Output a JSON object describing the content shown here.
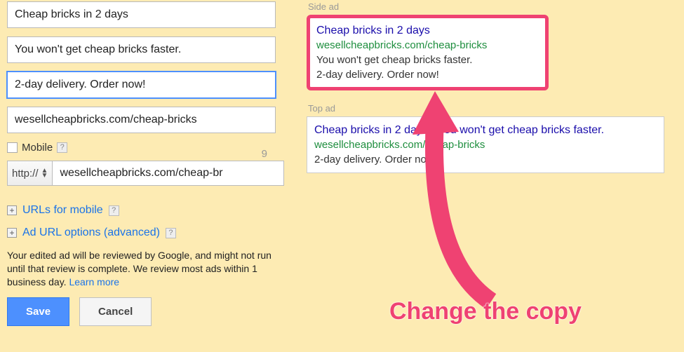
{
  "form": {
    "headline": "Cheap bricks in 2 days",
    "desc1": "You won't get cheap bricks faster.",
    "desc2": "2-day delivery. Order now!",
    "desc2_remaining": "9",
    "display_url": "wesellcheapbricks.com/cheap-bricks",
    "mobile_label": "Mobile",
    "protocol": "http://",
    "final_url": "wesellcheapbricks.com/cheap-br",
    "expand_urls_mobile": "URLs for mobile",
    "expand_ad_url_options": "Ad URL options (advanced)",
    "review_note": "Your edited ad will be reviewed by Google, and might not run until that review is complete. We review most ads within 1 business day.",
    "learn_more": "Learn more",
    "save": "Save",
    "cancel": "Cancel"
  },
  "preview": {
    "side_label": "Side ad",
    "side": {
      "headline": "Cheap bricks in 2 days",
      "url": "wesellcheapbricks.com/cheap-bricks",
      "line1": "You won't get cheap bricks faster.",
      "line2": "2-day delivery. Order now!"
    },
    "top_label": "Top ad",
    "top": {
      "headline": "Cheap bricks in 2 days - You won't get cheap bricks faster.",
      "url": "wesellcheapbricks.com/cheap-bricks",
      "line1": "2-day delivery. Order now!"
    }
  },
  "annotation": "Change the copy"
}
